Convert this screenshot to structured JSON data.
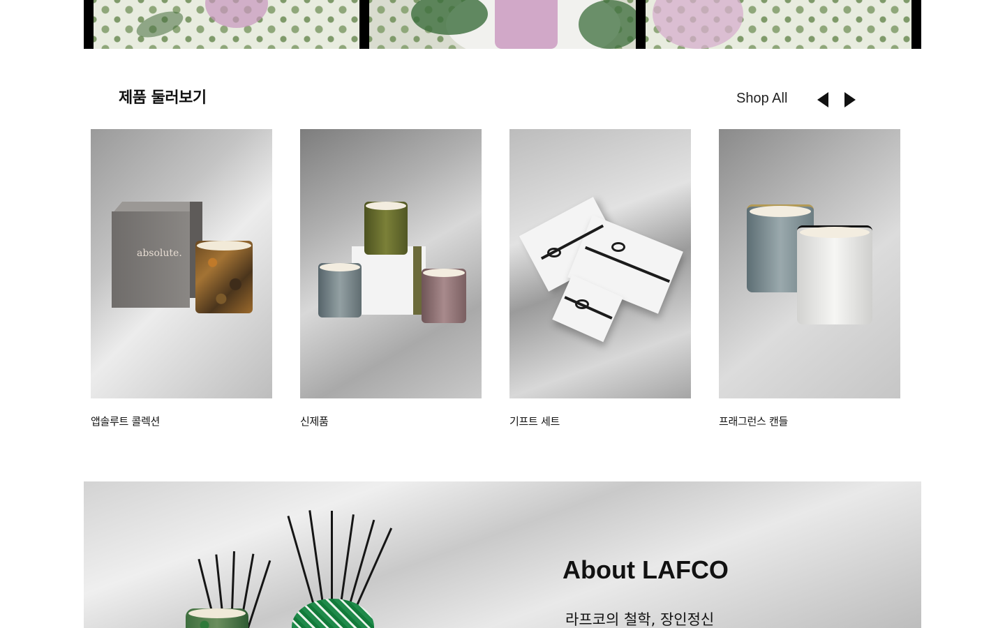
{
  "top_strip": {
    "images": [
      {
        "alt": "table setting with floral tablecloth 1"
      },
      {
        "alt": "table setting with floral tablecloth 2"
      },
      {
        "alt": "table setting with floral tablecloth 3"
      }
    ]
  },
  "products_section": {
    "title": "제품 둘러보기",
    "shop_all_label": "Shop All",
    "prev_icon": "caret-left-icon",
    "next_icon": "caret-right-icon",
    "cards": [
      {
        "label": "앱솔루트 콜렉션",
        "box_text": "absolute."
      },
      {
        "label": "신제품"
      },
      {
        "label": "기프트 세트"
      },
      {
        "label": "프래그런스 캔들"
      }
    ]
  },
  "about": {
    "title": "About LAFCO",
    "subtitle": "라프코의 철학, 장인정신"
  }
}
